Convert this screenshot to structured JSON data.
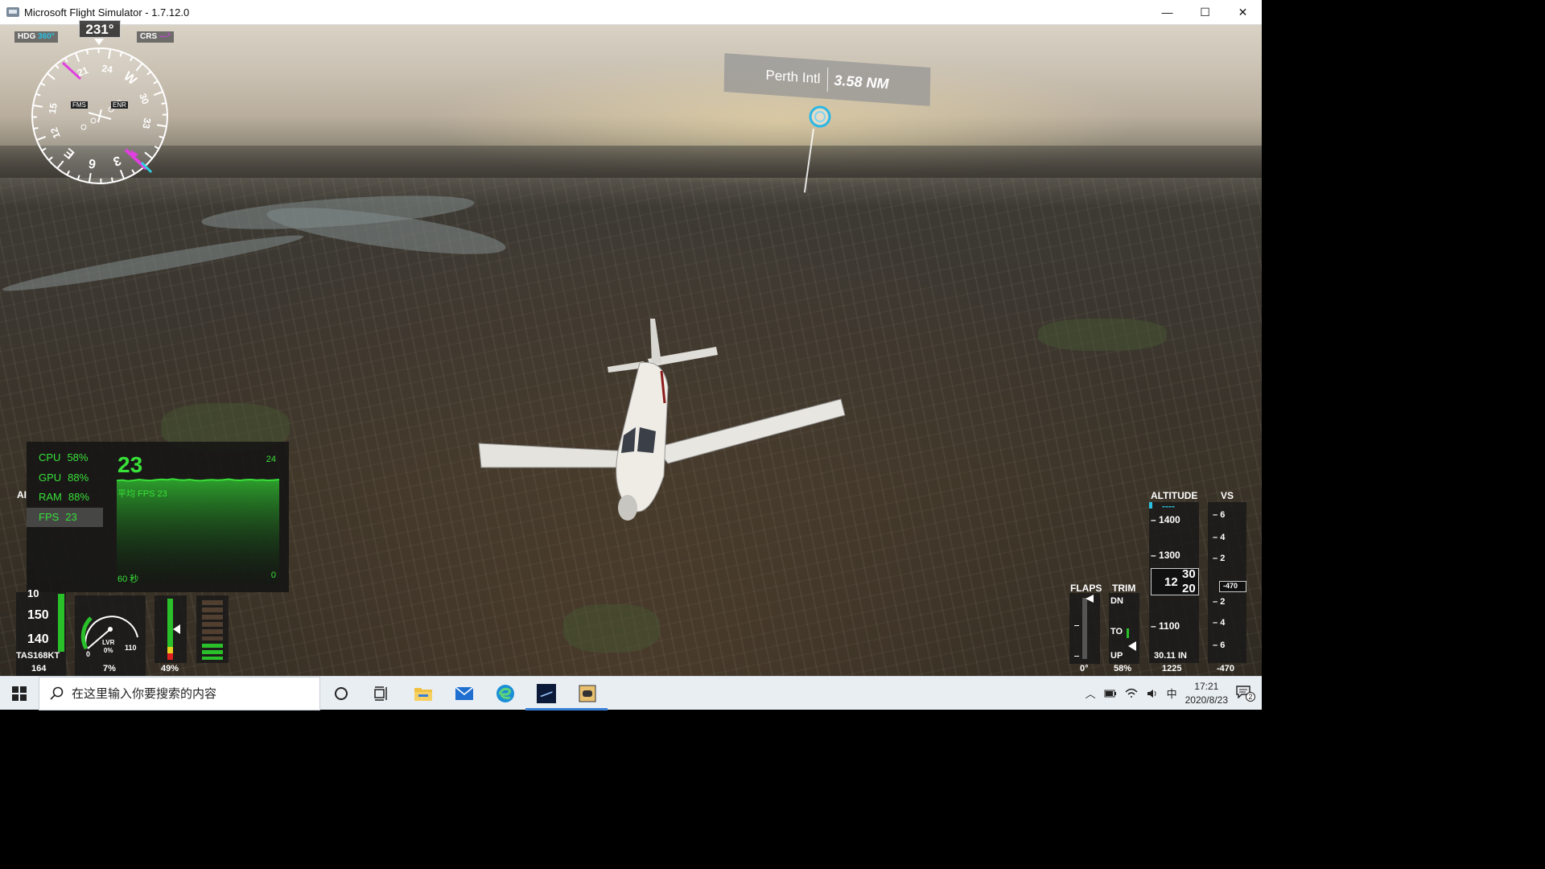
{
  "window": {
    "title": "Microsoft Flight Simulator - 1.7.12.0",
    "minimize": "—",
    "maximize": "☐",
    "close": "✕"
  },
  "nav": {
    "hdg_label": "HDG",
    "hdg_value": "360°",
    "crs_label": "CRS",
    "crs_value": "---°",
    "heading": "231°",
    "compass_marks": [
      "24",
      "W",
      "30",
      "33",
      "3",
      "6",
      "E",
      "12",
      "15",
      "21"
    ],
    "fms_label": "FMS",
    "enr_label": "ENR"
  },
  "waypoint": {
    "name": "Perth Intl",
    "distance": "3.58 NM"
  },
  "perf": {
    "stats": [
      {
        "label": "CPU",
        "value": "58%"
      },
      {
        "label": "GPU",
        "value": "88%"
      },
      {
        "label": "RAM",
        "value": "88%"
      },
      {
        "label": "FPS",
        "value": "23"
      }
    ],
    "fps_current": "23",
    "fps_max": "24",
    "fps_avg": "平均 FPS  23",
    "window": "60 秒",
    "fps_min": "0",
    "graph_values": [
      22,
      22.3,
      21.8,
      22.1,
      22.6,
      22.2,
      22,
      22.4,
      22.7,
      22.5,
      22.9,
      22.4,
      22.2,
      22.6,
      22.1,
      21.9,
      22.3,
      22.5,
      22.2,
      22.4,
      22.8,
      22.3,
      22.1,
      22.5,
      22.6,
      22.2,
      22.4,
      22.1,
      22.3,
      22.6
    ],
    "accent": "#38e038"
  },
  "airspeed": {
    "label": "AI",
    "ticks": [
      "150",
      "140",
      "10"
    ],
    "tas_label": "TAS168KT",
    "ias": "164"
  },
  "engine": {
    "rpm_label": "LVR",
    "rpm_value": "0%",
    "rpm_low": "0",
    "rpm_high": "110",
    "rpm_pct": "7%",
    "throttle_pct": "49%"
  },
  "flaps": {
    "label": "FLAPS",
    "value": "0°"
  },
  "trim": {
    "label": "TRIM",
    "dn": "DN",
    "to": "TO",
    "up": "UP",
    "value": "58%"
  },
  "altitude": {
    "label": "ALTITUDE",
    "target": "----",
    "ticks": [
      "1400",
      "1300",
      "1200",
      "1100"
    ],
    "current_hundreds": "12",
    "current_tens_top": "30",
    "current_tens_bottom": "20",
    "baro": "30.11 IN",
    "value": "1225"
  },
  "vs": {
    "label": "VS",
    "ticks": [
      "6",
      "4",
      "2",
      "2",
      "4",
      "6"
    ],
    "indicator": "-470",
    "value": "-470"
  },
  "taskbar": {
    "search_placeholder": "在这里输入你要搜索的内容",
    "ime": "中",
    "time": "17:21",
    "date": "2020/8/23",
    "notifications": "2"
  }
}
